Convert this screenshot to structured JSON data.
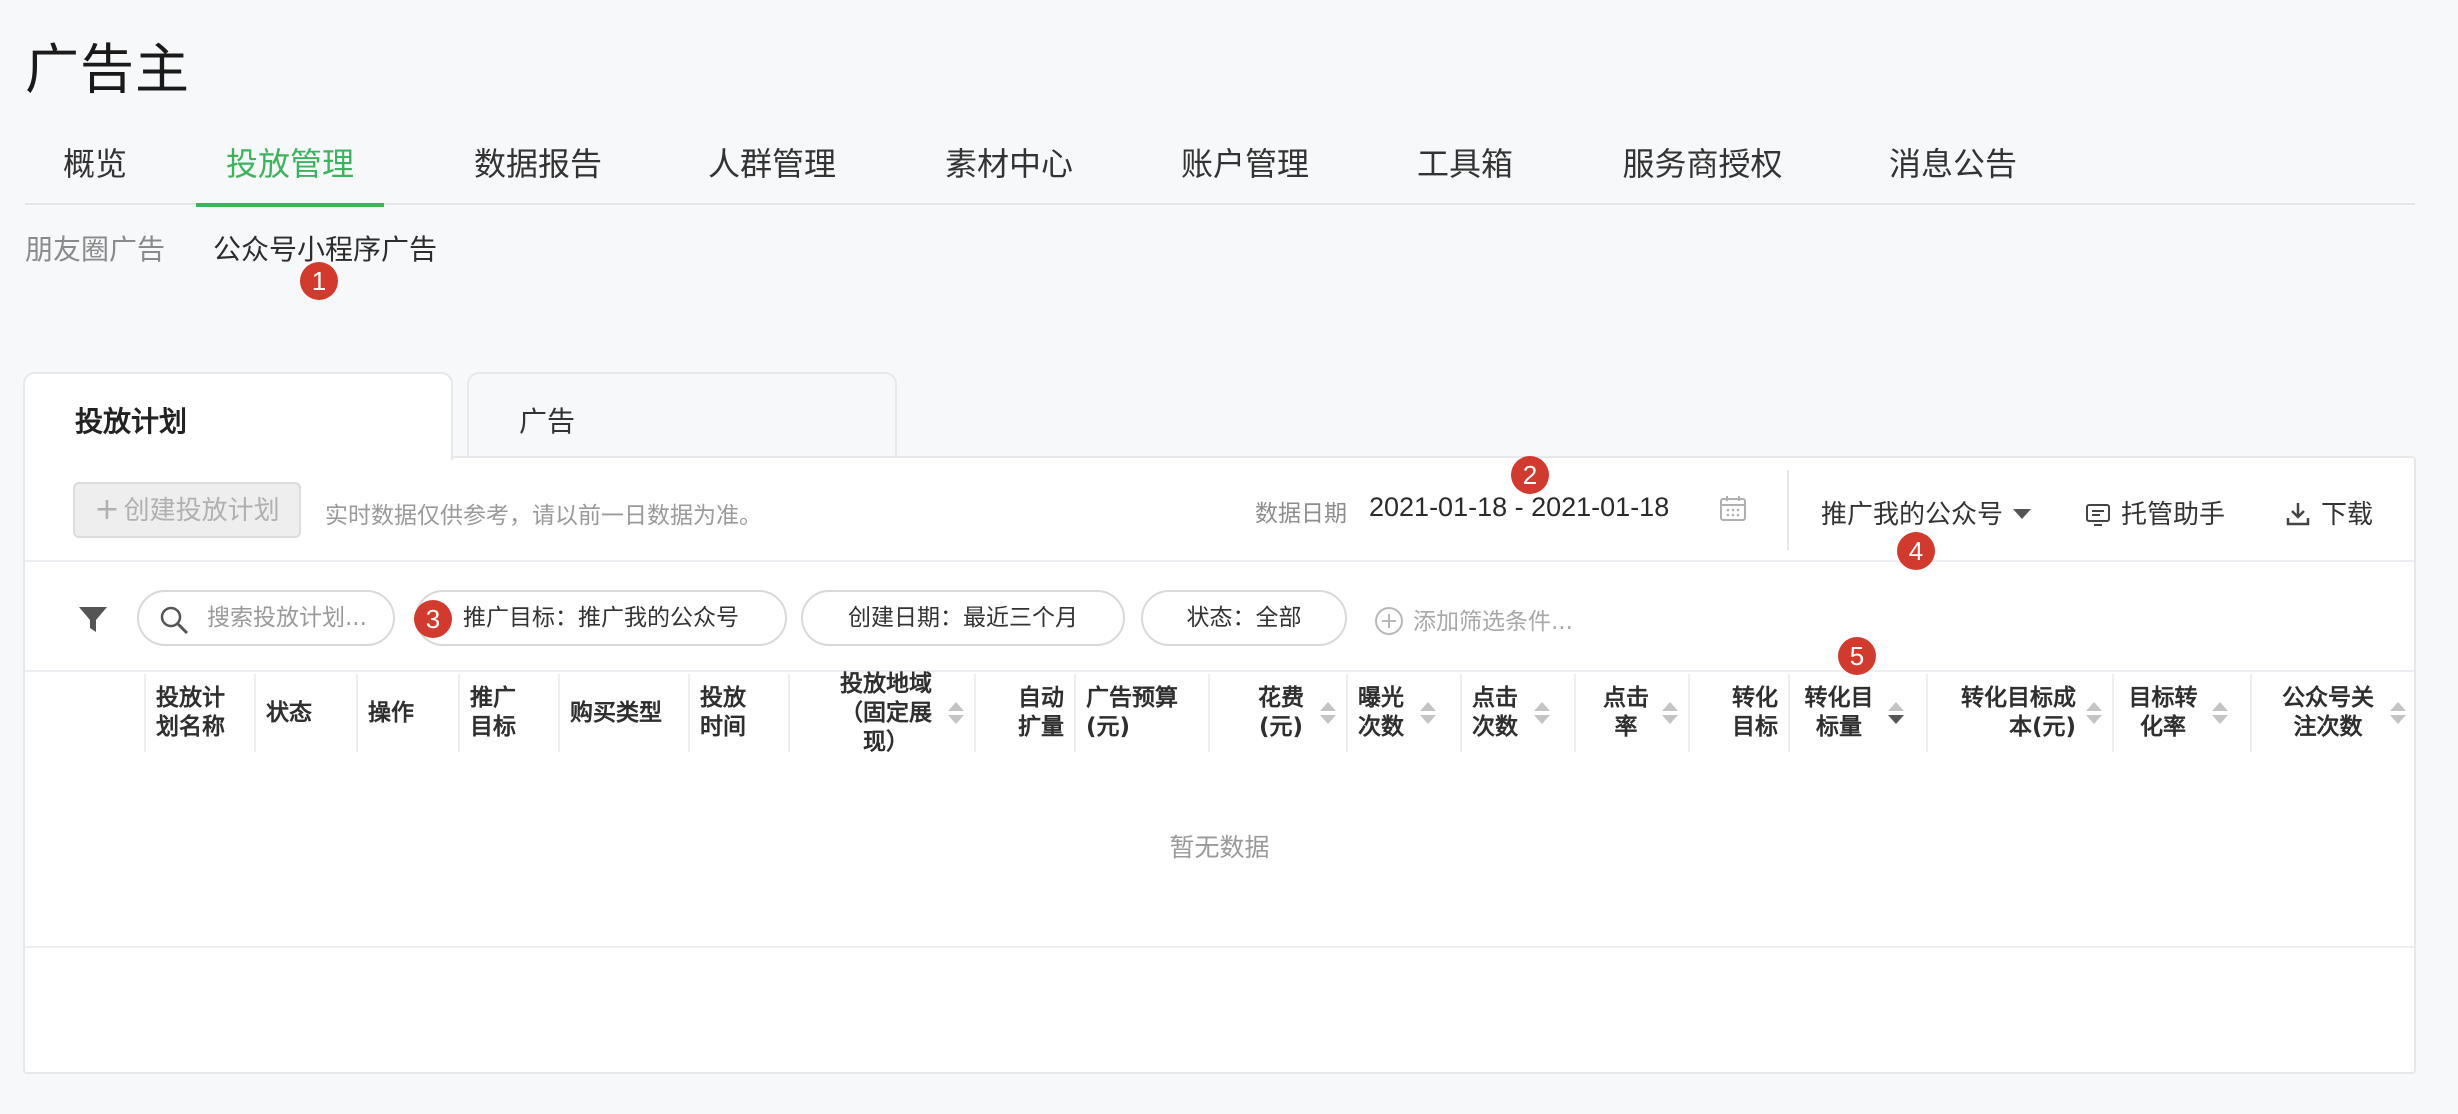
{
  "app": {
    "title": "广告主"
  },
  "main_nav": [
    {
      "label": "概览",
      "active": false
    },
    {
      "label": "投放管理",
      "active": true
    },
    {
      "label": "数据报告",
      "active": false
    },
    {
      "label": "人群管理",
      "active": false
    },
    {
      "label": "素材中心",
      "active": false
    },
    {
      "label": "账户管理",
      "active": false
    },
    {
      "label": "工具箱",
      "active": false
    },
    {
      "label": "服务商授权",
      "active": false
    },
    {
      "label": "消息公告",
      "active": false
    }
  ],
  "sub_nav": [
    {
      "label": "朋友圈广告",
      "active": false
    },
    {
      "label": "公众号小程序广告",
      "active": true
    }
  ],
  "tabs": [
    {
      "label": "投放计划",
      "active": true
    },
    {
      "label": "广告",
      "active": false
    }
  ],
  "toolbar": {
    "create_label": "创建投放计划",
    "hint": "实时数据仅供参考，请以前一日数据为准。",
    "date_label": "数据日期",
    "date_range": "2021-01-18 - 2021-01-18",
    "account_select": "推广我的公众号",
    "managed_label": "托管助手",
    "download_label": "下载"
  },
  "filters": {
    "search_placeholder": "搜索投放计划...",
    "chips": [
      "推广目标：推广我的公众号",
      "创建日期：最近三个月",
      "状态：全部"
    ],
    "add_label": "添加筛选条件..."
  },
  "table": {
    "columns": [
      {
        "label": "投放计划名称",
        "sortable": false
      },
      {
        "label": "状态",
        "sortable": false
      },
      {
        "label": "操作",
        "sortable": false
      },
      {
        "label": "推广目标",
        "sortable": false
      },
      {
        "label": "购买类型",
        "sortable": false
      },
      {
        "label": "投放时间",
        "sortable": false
      },
      {
        "label": "投放地域（固定展现）",
        "sortable": true
      },
      {
        "label": "自动扩量",
        "sortable": false
      },
      {
        "label": "广告预算(元)",
        "sortable": false
      },
      {
        "label": "花费(元)",
        "sortable": true
      },
      {
        "label": "曝光次数",
        "sortable": true
      },
      {
        "label": "点击次数",
        "sortable": true
      },
      {
        "label": "点击率",
        "sortable": true
      },
      {
        "label": "转化目标",
        "sortable": false
      },
      {
        "label": "转化目标量",
        "sortable": true,
        "sort": "desc"
      },
      {
        "label": "转化目标成本(元)",
        "sortable": true
      },
      {
        "label": "目标转化率",
        "sortable": true
      },
      {
        "label": "公众号关注次数",
        "sortable": true
      }
    ],
    "empty_text": "暂无数据"
  },
  "annotations": [
    "1",
    "2",
    "3",
    "4",
    "5"
  ],
  "colors": {
    "accent": "#3eb35e",
    "badge": "#d13a2d"
  }
}
